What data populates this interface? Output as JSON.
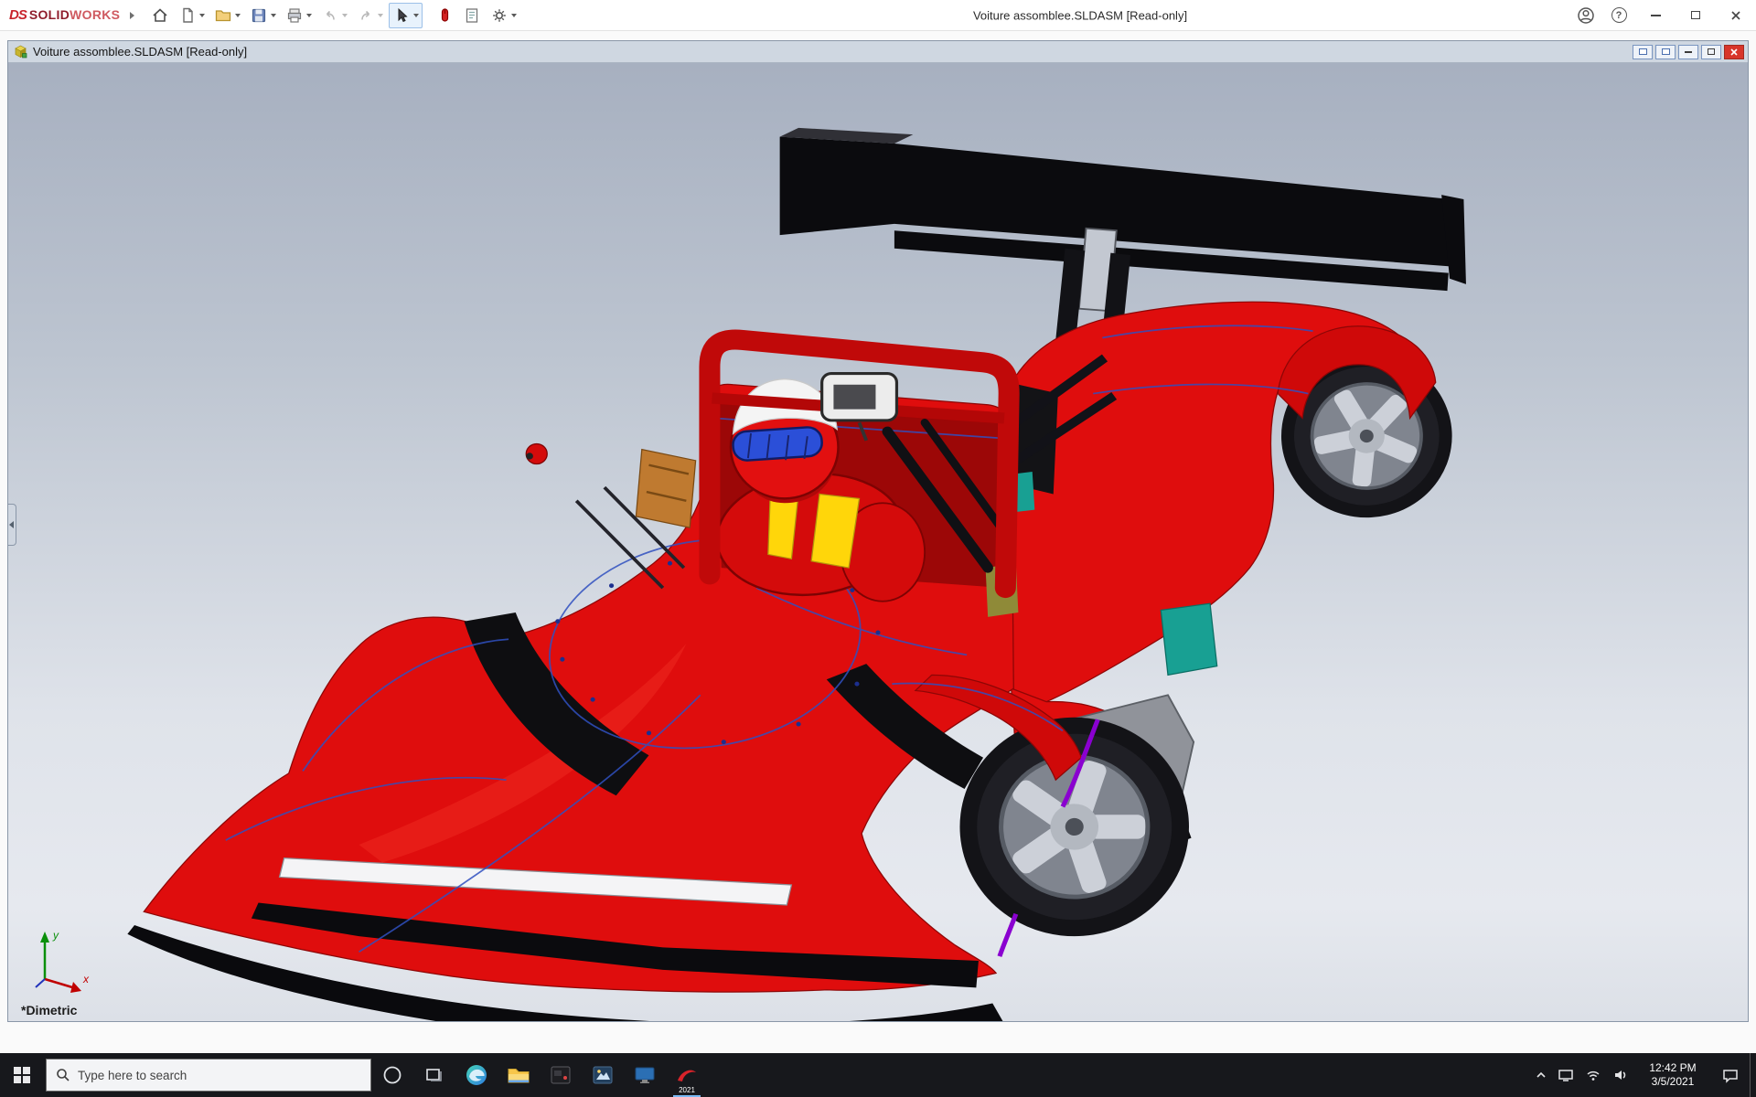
{
  "titlebar": {
    "brand_ds": "DS",
    "brand_solid": "SOLID",
    "brand_works": "WORKS",
    "document_title": "Voiture assomblee.SLDASM [Read-only]",
    "help_glyph": "?"
  },
  "document_window": {
    "title": "Voiture assomblee.SLDASM [Read-only]",
    "view_orientation": "*Dimetric",
    "triad": {
      "x_label": "x",
      "y_label": "y"
    }
  },
  "taskbar": {
    "search_placeholder": "Type here to search",
    "solidworks_badge": "2021",
    "clock": {
      "time": "12:42 PM",
      "date": "3/5/2021"
    }
  },
  "colors": {
    "car_body": "#df0d0d",
    "wing_black": "#0b0b0e",
    "visor_blue": "#2b4fd8",
    "accent_yellow": "#ffd60a",
    "accent_teal": "#18a093",
    "accent_orange": "#bf7a30",
    "accent_purple": "#8a00d0",
    "edge_blue": "#3050c0",
    "viewport_top": "#a7b0c0",
    "viewport_bottom": "#e6e9ef",
    "doc_titlebar_bg": "#cfd7e1",
    "taskbar_bg": "#17181c",
    "close_red": "#d8352a"
  }
}
